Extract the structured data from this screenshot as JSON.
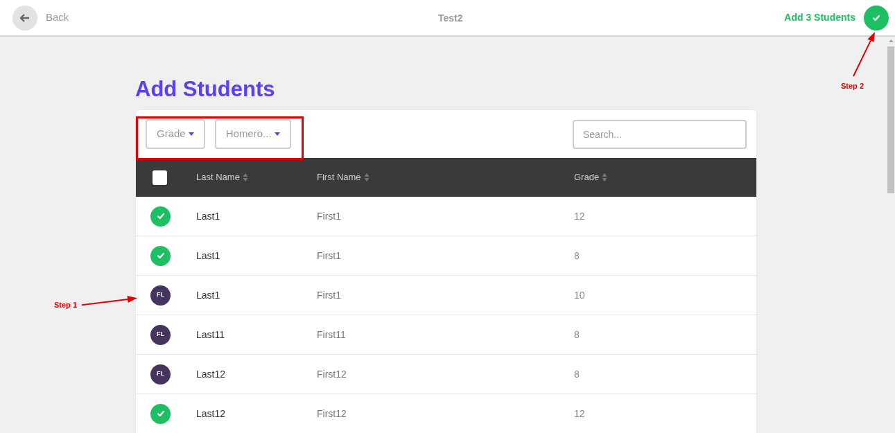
{
  "top_bar": {
    "back_label": "Back",
    "title": "Test2",
    "action_label": "Add 3 Students"
  },
  "heading": "Add Students",
  "filters": [
    {
      "label": "Grade"
    },
    {
      "label": "Homero..."
    }
  ],
  "search": {
    "placeholder": "Search..."
  },
  "table": {
    "select_all": {
      "checked": false
    },
    "columns": [
      "Last Name",
      "First Name",
      "Grade"
    ],
    "rows": [
      {
        "selected": true,
        "last_name": "Last1",
        "first_name": "First1",
        "grade": "12"
      },
      {
        "selected": true,
        "last_name": "Last1",
        "first_name": "First1",
        "grade": "8"
      },
      {
        "selected": false,
        "initials": "FL",
        "last_name": "Last1",
        "first_name": "First1",
        "grade": "10"
      },
      {
        "selected": false,
        "initials": "FL",
        "last_name": "Last11",
        "first_name": "First11",
        "grade": "8"
      },
      {
        "selected": false,
        "initials": "FL",
        "last_name": "Last12",
        "first_name": "First12",
        "grade": "8"
      },
      {
        "selected": true,
        "last_name": "Last12",
        "first_name": "First12",
        "grade": "12"
      }
    ]
  },
  "annotations": [
    {
      "label": "Step 1"
    },
    {
      "label": "Step 2"
    }
  ]
}
